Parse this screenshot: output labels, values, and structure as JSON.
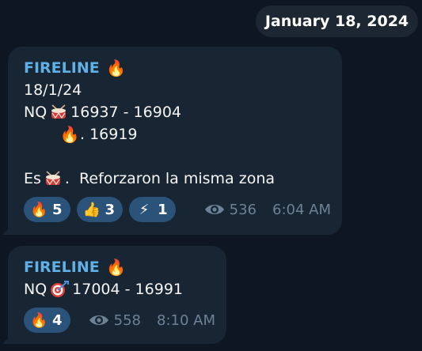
{
  "date_separator": "January 18, 2024",
  "messages": [
    {
      "sender": "FIRELINE",
      "sender_icon": "fire-icon",
      "lines": {
        "date": "18/1/24",
        "nq_prefix": "NQ",
        "nq_range": "16937 - 16904",
        "level": ". 16919",
        "es_prefix": "Es",
        "es_text": ".  Reforzaron la misma zona"
      },
      "reactions": [
        {
          "icon": "fire-icon",
          "emoji": "🔥",
          "count": "5"
        },
        {
          "icon": "thumbs-up-icon",
          "emoji": "👍",
          "count": "3"
        },
        {
          "icon": "lightning-icon",
          "emoji": "⚡",
          "count": "1"
        }
      ],
      "views": "536",
      "time": "6:04 AM"
    },
    {
      "sender": "FIRELINE",
      "sender_icon": "fire-icon",
      "lines": {
        "nq_prefix": "NQ",
        "nq_range": "17004 - 16991"
      },
      "reactions": [
        {
          "icon": "fire-icon",
          "emoji": "🔥",
          "count": "4"
        }
      ],
      "views": "558",
      "time": "8:10 AM"
    }
  ],
  "colors": {
    "background": "#0e1621",
    "bubble": "#182533",
    "sender": "#5eb0e5",
    "reaction_bg": "#2b5278",
    "meta": "#6d8296"
  }
}
